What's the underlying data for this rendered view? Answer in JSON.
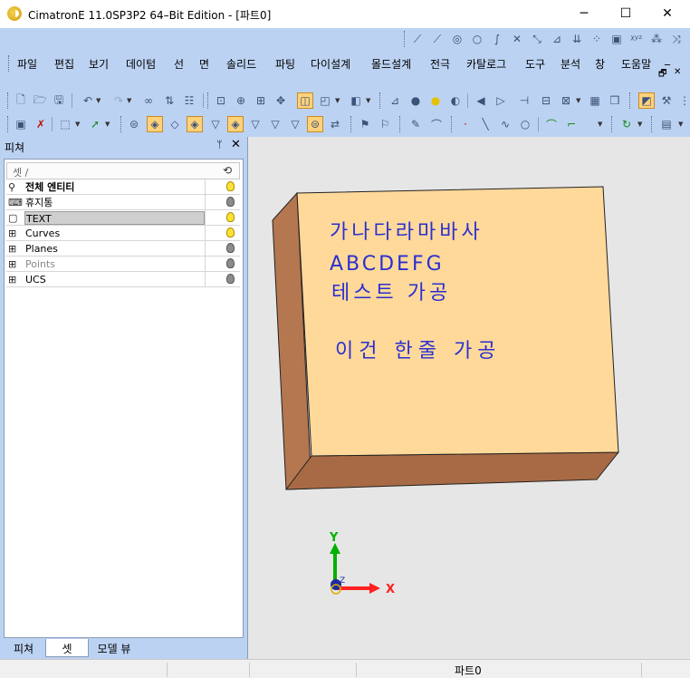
{
  "window": {
    "title": "CimatronE 11.0SP3P2 64–Bit Edition - [파트0]",
    "controls": {
      "minimize": "─",
      "maximize": "☐",
      "close": "✕"
    },
    "inner_controls": {
      "restore": "🗗",
      "close": "✕"
    }
  },
  "menu": {
    "items": [
      "파일",
      "편집",
      "보기",
      "데이텀",
      "선",
      "면",
      "솔리드",
      "파팅",
      "다이설계",
      "몰드설계",
      "전극",
      "카탈로그",
      "도구",
      "분석",
      "창",
      "도움말"
    ]
  },
  "panel": {
    "title": "피쳐",
    "pin": "ᛘ",
    "close": "✕",
    "set_header": {
      "name": "셋 /",
      "icon": "⟲"
    },
    "rows": [
      {
        "name": "전체 엔티티",
        "icon": "⚲",
        "style": "bold",
        "light": "on"
      },
      {
        "name": "휴지통",
        "icon": "⌨",
        "style": "normal",
        "light": "off"
      },
      {
        "name": "TEXT",
        "icon": "▢",
        "style": "highlight",
        "light": "on"
      },
      {
        "name": "Curves",
        "icon": "⊞",
        "style": "normal",
        "light": "on"
      },
      {
        "name": "Planes",
        "icon": "⊞",
        "style": "normal",
        "light": "off"
      },
      {
        "name": "Points",
        "icon": "⊞",
        "style": "gray",
        "light": "off"
      },
      {
        "name": "UCS",
        "icon": "⊞",
        "style": "normal",
        "light": "off"
      }
    ],
    "tabs": [
      "피쳐",
      "셋",
      "모델 뷰"
    ],
    "active_tab": "셋"
  },
  "viewport": {
    "box_text_lines": [
      "가나다라마바사",
      "ABCDEFG",
      "테스트 가공",
      "이건 한줄 가공"
    ],
    "axes": {
      "x": "X",
      "y": "Y",
      "z": "Z"
    },
    "colors": {
      "box_face": "#ffd99a",
      "box_side": "#b5774f",
      "box_bottom": "#a86a45",
      "text": "#2a2fd0",
      "axis_x": "#ff2020",
      "axis_y": "#00b000",
      "axis_z": "#1e2aa0",
      "background": "#e6e6e6"
    }
  },
  "statusbar": {
    "text": "파트0"
  },
  "colors": {
    "chrome_bg": "#bcd2f2",
    "selected_tool": "#ffd27a"
  }
}
